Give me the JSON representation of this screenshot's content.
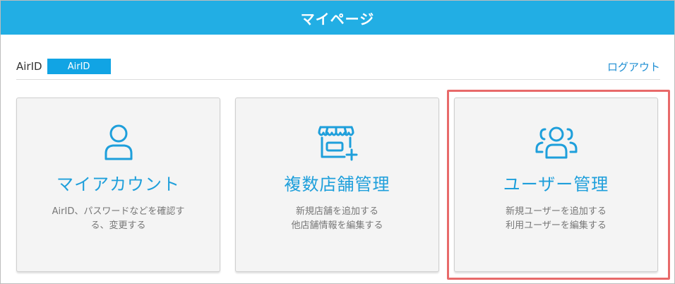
{
  "header": {
    "title": "マイページ"
  },
  "account": {
    "airid_label": "AirID",
    "airid_value": "AirID",
    "logout_label": "ログアウト"
  },
  "cards": [
    {
      "icon": "person-icon",
      "title": "マイアカウント",
      "desc_lines": [
        "AirID、パスワードなどを確認す",
        "る、変更する"
      ]
    },
    {
      "icon": "shop-add-icon",
      "title": "複数店舗管理",
      "desc_lines": [
        "新規店舗を追加する",
        "他店舗情報を編集する"
      ]
    },
    {
      "icon": "users-group-icon",
      "title": "ユーザー管理",
      "desc_lines": [
        "新規ユーザーを追加する",
        "利用ユーザーを編集する"
      ],
      "highlighted": true
    }
  ],
  "colors": {
    "header_bg": "#22aee4",
    "accent": "#1e9fdb",
    "badge_bg": "#11a4e4",
    "highlight": "#e86a6a"
  }
}
